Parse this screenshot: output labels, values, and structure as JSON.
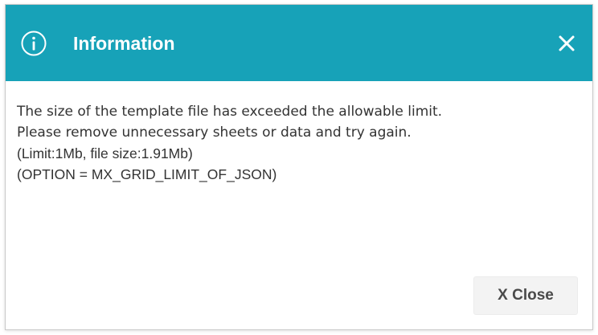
{
  "dialog": {
    "title": "Information",
    "message_lines": [
      "The size of the template file has exceeded the allowable limit.",
      "Please remove unnecessary sheets or data and try again.",
      "(Limit:1Mb, file size:1.91Mb)",
      "(OPTION = MX_GRID_LIMIT_OF_JSON)"
    ],
    "close_button_label": "X Close",
    "header_color": "#17a2b8",
    "icons": {
      "header_icon": "info-icon",
      "header_close": "close-icon"
    }
  }
}
